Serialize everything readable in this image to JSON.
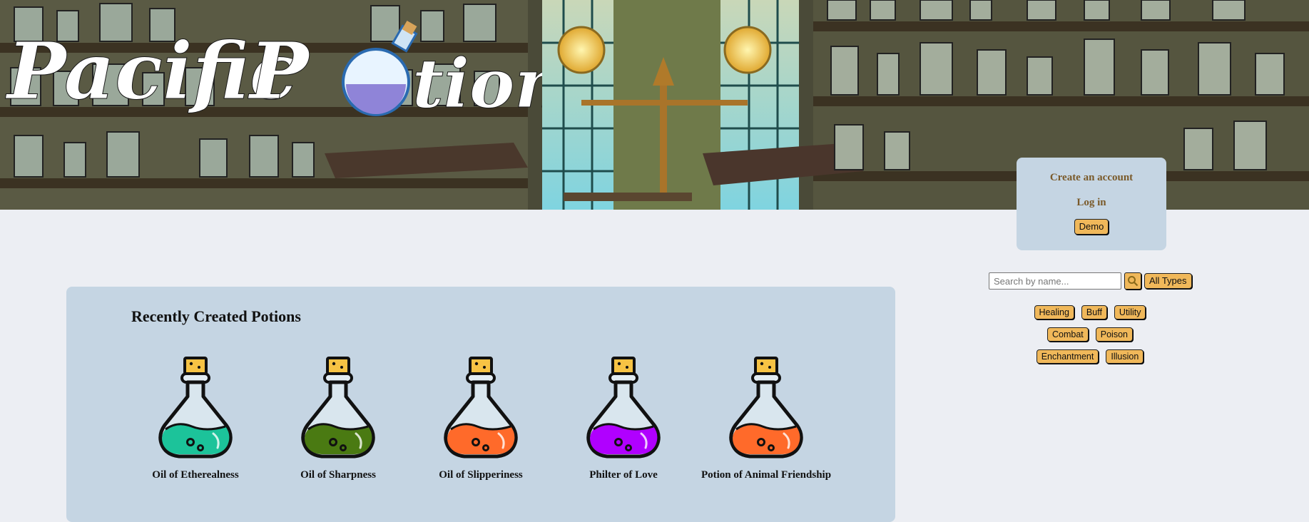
{
  "brand": {
    "logo_text": "Pacific Potion"
  },
  "account": {
    "create_label": "Create an account",
    "login_label": "Log in",
    "demo_label": "Demo"
  },
  "search": {
    "placeholder": "Search by name...",
    "search_icon": "magnifier-icon",
    "all_types_label": "All Types"
  },
  "types": {
    "row1": [
      "Healing",
      "Buff",
      "Utility"
    ],
    "row2": [
      "Combat",
      "Poison"
    ],
    "row3": [
      "Enchantment",
      "Illusion"
    ]
  },
  "recent": {
    "title": "Recently Created Potions",
    "potions": [
      {
        "name": "Oil of Etherealness",
        "color": "#1cc39a"
      },
      {
        "name": "Oil of Sharpness",
        "color": "#4a7a12"
      },
      {
        "name": "Oil of Slipperiness",
        "color": "#ff6a2a"
      },
      {
        "name": "Philter of Love",
        "color": "#b000ff"
      },
      {
        "name": "Potion of Animal Friendship",
        "color": "#ff6a2a"
      }
    ]
  },
  "colors": {
    "page_bg": "#eceef3",
    "panel_bg": "#c5d5e3",
    "button": "#f0b85a",
    "link": "#7a5a2a"
  }
}
